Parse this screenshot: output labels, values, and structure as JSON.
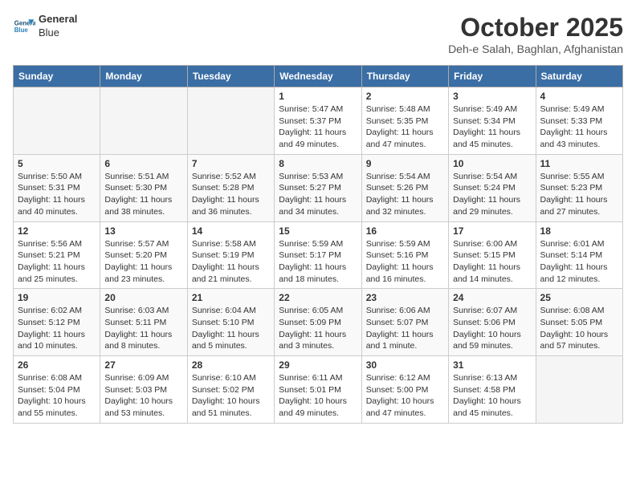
{
  "header": {
    "logo_line1": "General",
    "logo_line2": "Blue",
    "month_title": "October 2025",
    "location": "Deh-e Salah, Baghlan, Afghanistan"
  },
  "weekdays": [
    "Sunday",
    "Monday",
    "Tuesday",
    "Wednesday",
    "Thursday",
    "Friday",
    "Saturday"
  ],
  "weeks": [
    [
      {
        "day": "",
        "info": ""
      },
      {
        "day": "",
        "info": ""
      },
      {
        "day": "",
        "info": ""
      },
      {
        "day": "1",
        "info": "Sunrise: 5:47 AM\nSunset: 5:37 PM\nDaylight: 11 hours\nand 49 minutes."
      },
      {
        "day": "2",
        "info": "Sunrise: 5:48 AM\nSunset: 5:35 PM\nDaylight: 11 hours\nand 47 minutes."
      },
      {
        "day": "3",
        "info": "Sunrise: 5:49 AM\nSunset: 5:34 PM\nDaylight: 11 hours\nand 45 minutes."
      },
      {
        "day": "4",
        "info": "Sunrise: 5:49 AM\nSunset: 5:33 PM\nDaylight: 11 hours\nand 43 minutes."
      }
    ],
    [
      {
        "day": "5",
        "info": "Sunrise: 5:50 AM\nSunset: 5:31 PM\nDaylight: 11 hours\nand 40 minutes."
      },
      {
        "day": "6",
        "info": "Sunrise: 5:51 AM\nSunset: 5:30 PM\nDaylight: 11 hours\nand 38 minutes."
      },
      {
        "day": "7",
        "info": "Sunrise: 5:52 AM\nSunset: 5:28 PM\nDaylight: 11 hours\nand 36 minutes."
      },
      {
        "day": "8",
        "info": "Sunrise: 5:53 AM\nSunset: 5:27 PM\nDaylight: 11 hours\nand 34 minutes."
      },
      {
        "day": "9",
        "info": "Sunrise: 5:54 AM\nSunset: 5:26 PM\nDaylight: 11 hours\nand 32 minutes."
      },
      {
        "day": "10",
        "info": "Sunrise: 5:54 AM\nSunset: 5:24 PM\nDaylight: 11 hours\nand 29 minutes."
      },
      {
        "day": "11",
        "info": "Sunrise: 5:55 AM\nSunset: 5:23 PM\nDaylight: 11 hours\nand 27 minutes."
      }
    ],
    [
      {
        "day": "12",
        "info": "Sunrise: 5:56 AM\nSunset: 5:21 PM\nDaylight: 11 hours\nand 25 minutes."
      },
      {
        "day": "13",
        "info": "Sunrise: 5:57 AM\nSunset: 5:20 PM\nDaylight: 11 hours\nand 23 minutes."
      },
      {
        "day": "14",
        "info": "Sunrise: 5:58 AM\nSunset: 5:19 PM\nDaylight: 11 hours\nand 21 minutes."
      },
      {
        "day": "15",
        "info": "Sunrise: 5:59 AM\nSunset: 5:17 PM\nDaylight: 11 hours\nand 18 minutes."
      },
      {
        "day": "16",
        "info": "Sunrise: 5:59 AM\nSunset: 5:16 PM\nDaylight: 11 hours\nand 16 minutes."
      },
      {
        "day": "17",
        "info": "Sunrise: 6:00 AM\nSunset: 5:15 PM\nDaylight: 11 hours\nand 14 minutes."
      },
      {
        "day": "18",
        "info": "Sunrise: 6:01 AM\nSunset: 5:14 PM\nDaylight: 11 hours\nand 12 minutes."
      }
    ],
    [
      {
        "day": "19",
        "info": "Sunrise: 6:02 AM\nSunset: 5:12 PM\nDaylight: 11 hours\nand 10 minutes."
      },
      {
        "day": "20",
        "info": "Sunrise: 6:03 AM\nSunset: 5:11 PM\nDaylight: 11 hours\nand 8 minutes."
      },
      {
        "day": "21",
        "info": "Sunrise: 6:04 AM\nSunset: 5:10 PM\nDaylight: 11 hours\nand 5 minutes."
      },
      {
        "day": "22",
        "info": "Sunrise: 6:05 AM\nSunset: 5:09 PM\nDaylight: 11 hours\nand 3 minutes."
      },
      {
        "day": "23",
        "info": "Sunrise: 6:06 AM\nSunset: 5:07 PM\nDaylight: 11 hours\nand 1 minute."
      },
      {
        "day": "24",
        "info": "Sunrise: 6:07 AM\nSunset: 5:06 PM\nDaylight: 10 hours\nand 59 minutes."
      },
      {
        "day": "25",
        "info": "Sunrise: 6:08 AM\nSunset: 5:05 PM\nDaylight: 10 hours\nand 57 minutes."
      }
    ],
    [
      {
        "day": "26",
        "info": "Sunrise: 6:08 AM\nSunset: 5:04 PM\nDaylight: 10 hours\nand 55 minutes."
      },
      {
        "day": "27",
        "info": "Sunrise: 6:09 AM\nSunset: 5:03 PM\nDaylight: 10 hours\nand 53 minutes."
      },
      {
        "day": "28",
        "info": "Sunrise: 6:10 AM\nSunset: 5:02 PM\nDaylight: 10 hours\nand 51 minutes."
      },
      {
        "day": "29",
        "info": "Sunrise: 6:11 AM\nSunset: 5:01 PM\nDaylight: 10 hours\nand 49 minutes."
      },
      {
        "day": "30",
        "info": "Sunrise: 6:12 AM\nSunset: 5:00 PM\nDaylight: 10 hours\nand 47 minutes."
      },
      {
        "day": "31",
        "info": "Sunrise: 6:13 AM\nSunset: 4:58 PM\nDaylight: 10 hours\nand 45 minutes."
      },
      {
        "day": "",
        "info": ""
      }
    ]
  ]
}
